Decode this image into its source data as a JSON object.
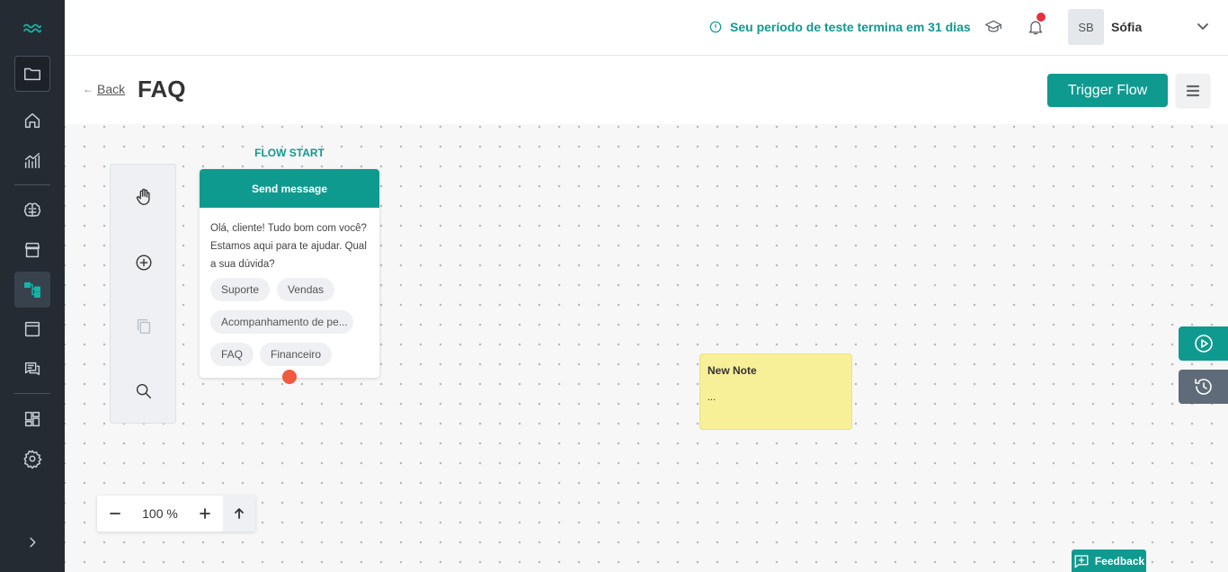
{
  "sidebar": {
    "icons": [
      "waves-logo-icon",
      "folder-icon",
      "home-icon",
      "analytics-icon",
      "brain-icon",
      "store-icon",
      "flows-icon",
      "window-icon",
      "chat-icon",
      "dashboard-icon",
      "settings-icon",
      "expand-chevron-icon"
    ],
    "active": "flows-icon",
    "accent_color": "#16b3a8"
  },
  "topbar": {
    "trial_text": "Seu período de teste termina em 31 dias",
    "icons": [
      "graduation-cap-icon",
      "bell-icon"
    ],
    "has_notification": true,
    "user_initials": "SB",
    "user_name": "Sófia"
  },
  "header": {
    "back_arrow": "←",
    "back_label": "Back",
    "title": "FAQ",
    "trigger_label": "Trigger Flow",
    "primary_color": "#0f9a90"
  },
  "toolbox": {
    "tools": [
      "hand-icon",
      "add-circle-icon",
      "copy-icon",
      "search-icon"
    ]
  },
  "flow": {
    "start_label": "FLOW START",
    "node_title": "Send message",
    "node_message": "Olá, cliente! Tudo bom com você? Estamos aqui para te ajudar. Qual a sua dúvida?",
    "options": [
      "Suporte",
      "Vendas",
      "Acompanhamento de pe...",
      "FAQ",
      "Financeiro"
    ]
  },
  "note": {
    "title": "New Note",
    "body": "..."
  },
  "zoom": {
    "value": "100 %"
  },
  "feedback_label": "Feedback"
}
